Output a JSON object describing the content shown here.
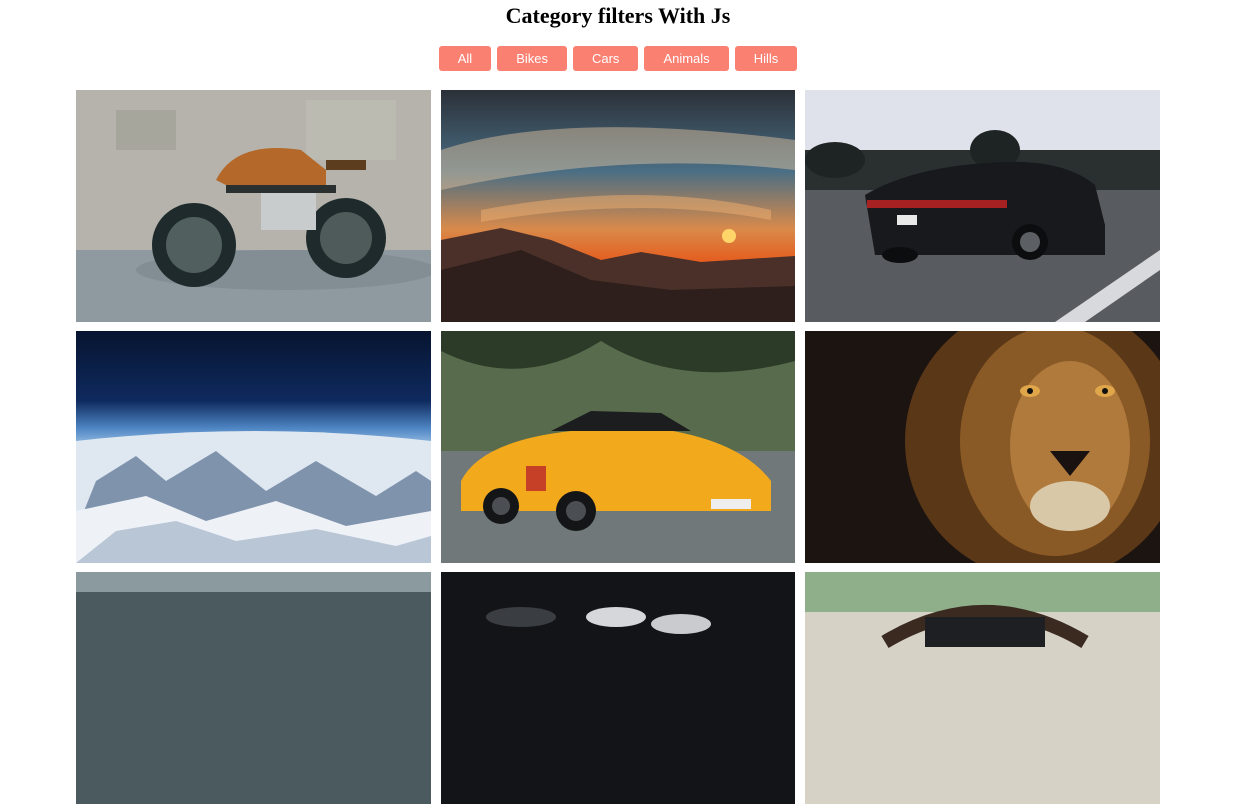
{
  "page": {
    "title": "Category filters With Js"
  },
  "filters": [
    {
      "label": "All"
    },
    {
      "label": "Bikes"
    },
    {
      "label": "Cars"
    },
    {
      "label": "Animals"
    },
    {
      "label": "Hills"
    }
  ],
  "gallery": [
    {
      "category": "bikes",
      "subject": "vintage motorcycle against concrete wall"
    },
    {
      "category": "hills",
      "subject": "sunset over mountain ridge"
    },
    {
      "category": "cars",
      "subject": "black sports sedan on highway"
    },
    {
      "category": "hills",
      "subject": "snowy mountains from high altitude"
    },
    {
      "category": "cars",
      "subject": "yellow sports car on tree-lined road"
    },
    {
      "category": "animals",
      "subject": "lion face close-up"
    },
    {
      "category": "hills",
      "subject": "glass building facade"
    },
    {
      "category": "cars",
      "subject": "cars in dark showroom"
    },
    {
      "category": "cars",
      "subject": "car interior steering wheel"
    }
  ],
  "colors": {
    "accent": "#fa8072",
    "button_text": "#ffffff"
  }
}
